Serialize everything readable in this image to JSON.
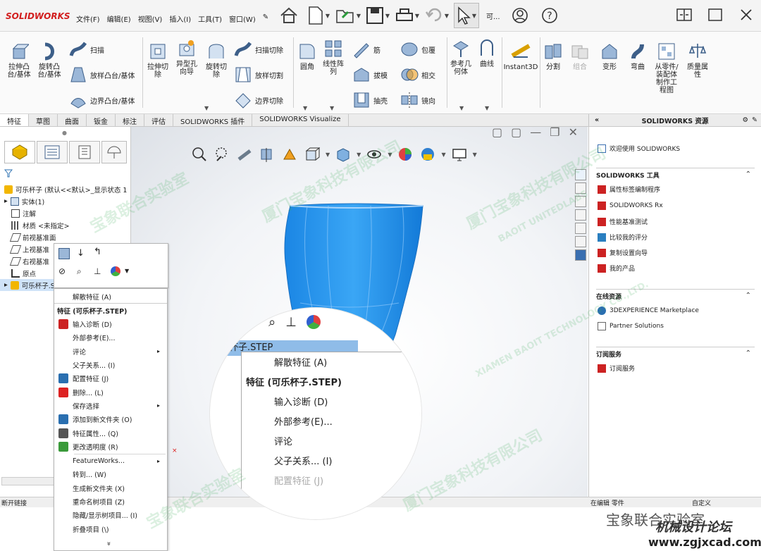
{
  "app": {
    "logo": "SOLIDWORKS",
    "menus": [
      "文件(F)",
      "编辑(E)",
      "视图(V)",
      "插入(I)",
      "工具(T)",
      "窗口(W)"
    ],
    "search_label": "可..."
  },
  "ribbon": {
    "big": [
      {
        "label": "拉伸凸\n台/基体",
        "icon": "extrude-boss-icon"
      },
      {
        "label": "旋转凸\n台/基体",
        "icon": "revolve-boss-icon"
      },
      {
        "label": "拉伸切\n除",
        "icon": "extrude-cut-icon"
      },
      {
        "label": "异型孔\n向导",
        "icon": "hole-wizard-icon"
      },
      {
        "label": "旋转切\n除",
        "icon": "revolve-cut-icon"
      },
      {
        "label": "圆角",
        "icon": "fillet-icon"
      },
      {
        "label": "线性阵\n列",
        "icon": "linear-pattern-icon"
      },
      {
        "label": "参考几\n何体",
        "icon": "ref-geometry-icon"
      },
      {
        "label": "曲线",
        "icon": "curves-icon"
      },
      {
        "label": "Instant3D",
        "icon": "instant3d-icon"
      },
      {
        "label": "分割",
        "icon": "split-icon"
      },
      {
        "label": "组合",
        "icon": "combine-icon"
      },
      {
        "label": "变形",
        "icon": "deform-icon"
      },
      {
        "label": "弯曲",
        "icon": "flex-icon"
      },
      {
        "label": "从零件/\n装配体\n制作工\n程图",
        "icon": "make-drawing-icon"
      },
      {
        "label": "质量属\n性",
        "icon": "mass-props-icon"
      }
    ],
    "small": [
      {
        "label": "扫描",
        "icon": "sweep-icon"
      },
      {
        "label": "放样凸台/基体",
        "icon": "loft-icon"
      },
      {
        "label": "边界凸台/基体",
        "icon": "boundary-boss-icon"
      },
      {
        "label": "扫描切除",
        "icon": "swept-cut-icon"
      },
      {
        "label": "放样切割",
        "icon": "lofted-cut-icon"
      },
      {
        "label": "边界切除",
        "icon": "boundary-cut-icon"
      },
      {
        "label": "筋",
        "icon": "rib-icon"
      },
      {
        "label": "拔模",
        "icon": "draft-icon"
      },
      {
        "label": "抽壳",
        "icon": "shell-icon"
      },
      {
        "label": "包覆",
        "icon": "wrap-icon"
      },
      {
        "label": "相交",
        "icon": "intersect-icon"
      },
      {
        "label": "镜向",
        "icon": "mirror-icon"
      }
    ]
  },
  "tabs": [
    "特征",
    "草图",
    "曲面",
    "钣金",
    "标注",
    "评估",
    "SOLIDWORKS 插件",
    "SOLIDWORKS Visualize"
  ],
  "tree": {
    "root": "可乐杯子 (默认<<默认>_显示状态 1",
    "items": [
      "实体(1)",
      "注解",
      "材质 <未指定>",
      "前视基准面",
      "上视基准",
      "右视基准",
      "原点",
      "可乐杯子.STEP"
    ]
  },
  "context_menu": {
    "items": [
      {
        "label": "解散特征 (A)",
        "icon": "",
        "arrow": ""
      },
      {
        "label": "特征 (可乐杯子.STEP)",
        "icon": "",
        "arrow": "",
        "header": true
      },
      {
        "label": "输入诊断 (D)",
        "icon": "import-diag-icon",
        "arrow": ""
      },
      {
        "label": "外部参考(E)...",
        "icon": "",
        "arrow": ""
      },
      {
        "label": "评论",
        "icon": "",
        "arrow": "▸"
      },
      {
        "label": "父子关系... (I)",
        "icon": "",
        "arrow": ""
      },
      {
        "label": "配置特征 (J)",
        "icon": "config-feature-icon",
        "arrow": ""
      },
      {
        "label": "删除... (L)",
        "icon": "delete-icon",
        "arrow": ""
      },
      {
        "label": "保存选择",
        "icon": "",
        "arrow": "▸"
      },
      {
        "label": "添加到新文件夹 (O)",
        "icon": "folder-icon",
        "arrow": ""
      },
      {
        "label": "特征属性... (Q)",
        "icon": "properties-icon",
        "arrow": ""
      },
      {
        "label": "更改透明度 (R)",
        "icon": "transparency-icon",
        "arrow": ""
      },
      {
        "label": "FeatureWorks...",
        "icon": "",
        "arrow": "▸"
      },
      {
        "label": "转到... (W)",
        "icon": "",
        "arrow": ""
      },
      {
        "label": "生成新文件夹 (X)",
        "icon": "",
        "arrow": ""
      },
      {
        "label": "重命名树项目 (Z)",
        "icon": "",
        "arrow": ""
      },
      {
        "label": "隐藏/显示树项目... (I)",
        "icon": "",
        "arrow": ""
      },
      {
        "label": "折叠项目 (\\)",
        "icon": "",
        "arrow": ""
      }
    ],
    "more": "»"
  },
  "magnifier": {
    "tree_label": "乐杯子.STEP",
    "items": [
      "解散特征 (A)",
      "特征 (可乐杯子.STEP)",
      "输入诊断 (D)",
      "外部参考(E)...",
      "评论",
      "父子关系... (I)",
      "配置特征 (J)"
    ]
  },
  "resources": {
    "title": "SOLIDWORKS 资源",
    "welcome": "欢迎使用 SOLIDWORKS",
    "tools_title": "SOLIDWORKS 工具",
    "tools": [
      "属性标签编制程序",
      "SOLIDWORKS Rx",
      "性能基准测试",
      "比较我的评分",
      "复制设置向导",
      "我的产品"
    ],
    "online_title": "在线资源",
    "online": [
      "3DEXPERIENCE Marketplace",
      "Partner Solutions"
    ],
    "sub_title": "订阅服务",
    "sub": [
      "订阅服务"
    ]
  },
  "status": {
    "left": "断开链接",
    "mid": "在编辑 零件",
    "right": "自定义"
  },
  "watermark": {
    "lines": [
      "厦门宝象科技有限公司",
      "XIAMEN BAOIT TECHNOLOGY CO.,LTD.",
      "宝象联合实验室",
      "BAOIT UNITEDLABS"
    ],
    "footer1": "宝象联合实验室",
    "footer2": "机械设计论坛",
    "footer3": "www.zgjxcad.com"
  },
  "colors": {
    "accent": "#1f7bd6",
    "cup": "#2e9cf0",
    "logo": "#d21e1e"
  }
}
